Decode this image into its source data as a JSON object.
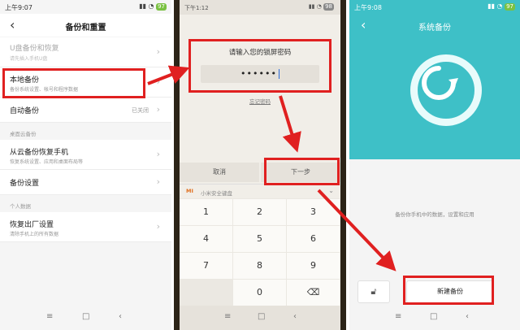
{
  "panel1": {
    "status": {
      "time": "上午9:07",
      "battery": "97"
    },
    "header": {
      "title": "备份和重置"
    },
    "rows": [
      {
        "title": "U盘备份和恢复",
        "subtitle": "请先插入手机U盘"
      },
      {
        "title": "本地备份",
        "subtitle": "备份系统设置、帐号和程序数据"
      },
      {
        "title": "自动备份",
        "value": "已关闭"
      }
    ],
    "section_cloud": "桌面云备份",
    "cloud_rows": [
      {
        "title": "从云备份恢复手机",
        "subtitle": "恢复系统设置、应用和桌面布局等"
      },
      {
        "title": "备份设置"
      }
    ],
    "section_personal": "个人数据",
    "personal_rows": [
      {
        "title": "恢复出厂设置",
        "subtitle": "清除手机上的所有数据"
      }
    ]
  },
  "panel2": {
    "status": {
      "time": "下午1:12",
      "battery": "98"
    },
    "prompt": "请输入您的锁屏密码",
    "password_mask": "••••••",
    "forgot": "忘记密码",
    "cancel": "取消",
    "next": "下一步",
    "keyboard_label": "小米安全键盘",
    "keyboard_logo": "MI",
    "keys": [
      "1",
      "2",
      "3",
      "4",
      "5",
      "6",
      "7",
      "8",
      "9",
      "",
      "0",
      "⌫"
    ]
  },
  "panel3": {
    "status": {
      "time": "上午9:08",
      "battery": "97"
    },
    "title": "系统备份",
    "desc": "备份你手机中的数据，设置和应用",
    "new_backup": "新建备份"
  },
  "colors": {
    "highlight": "#e02020",
    "teal": "#3ec0c7",
    "arrow": "#e02020"
  }
}
